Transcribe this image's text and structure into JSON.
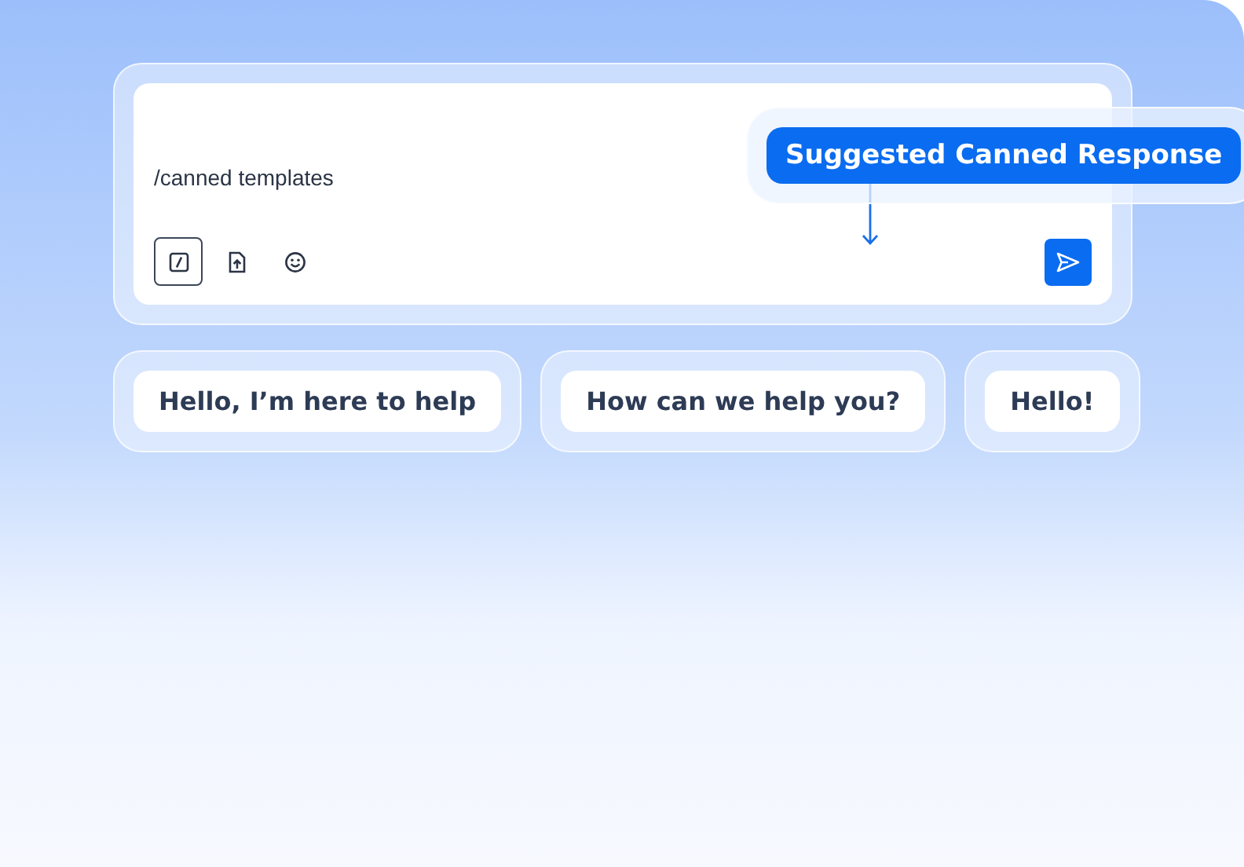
{
  "composer": {
    "value": "/canned templates",
    "tools": [
      {
        "kind": "slash",
        "selected": true
      },
      {
        "kind": "file-upload",
        "selected": false
      },
      {
        "kind": "emoji",
        "selected": false
      }
    ]
  },
  "tooltip": {
    "label": "Suggested Canned Response"
  },
  "suggestions": [
    "Hello, I’m here to help",
    "How can we help you?",
    "Hello!"
  ]
}
